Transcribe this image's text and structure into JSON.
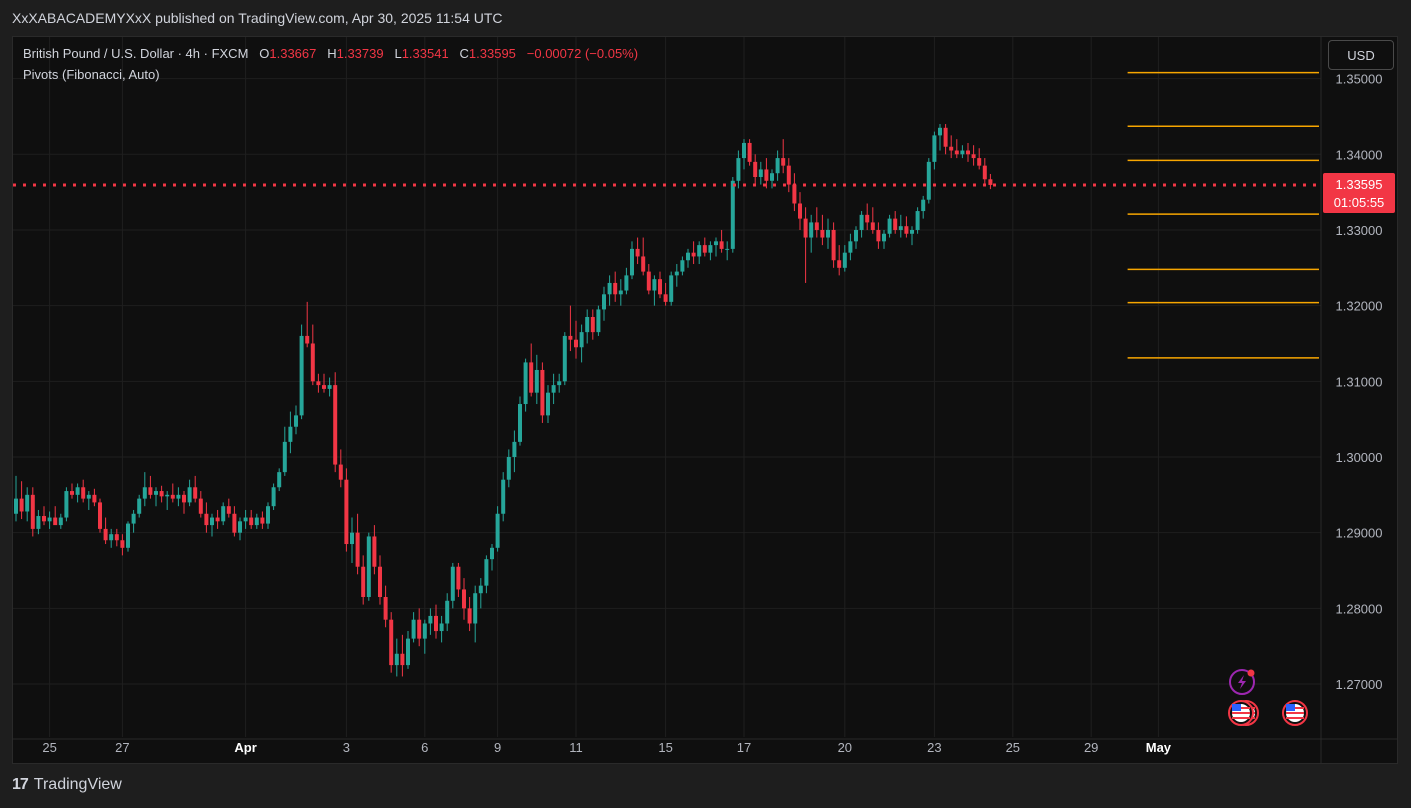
{
  "caption": "XxXABACADEMYXxX published on TradingView.com, Apr 30, 2025 11:54 UTC",
  "legend": {
    "symbol": "British Pound / U.S. Dollar · 4h · FXCM",
    "open_label": "O",
    "open": "1.33667",
    "high_label": "H",
    "high": "1.33739",
    "low_label": "L",
    "low": "1.33541",
    "close_label": "C",
    "close": "1.33595",
    "change": "−0.00072 (−0.05%)",
    "indicator": "Pivots (Fibonacci, Auto)"
  },
  "currency_button": "USD",
  "footer": {
    "brand": "TradingView",
    "logo": "17"
  },
  "colors": {
    "up": "#26a69a",
    "down": "#f23645",
    "pivot": "#f7a600",
    "price_line": "#f23645",
    "grid": "#1f1f1f",
    "axis_text": "#b2b5be"
  },
  "icons": [
    "lightning-icon",
    "us-flag-icon",
    "us-flag-icon"
  ],
  "chart_data": {
    "type": "candlestick",
    "interval": "4h",
    "y_axis": {
      "ylim": [
        1.263,
        1.3555
      ],
      "ticks": [
        "1.35000",
        "1.34000",
        "1.33000",
        "1.32000",
        "1.31000",
        "1.30000",
        "1.29000",
        "1.28000",
        "1.27000"
      ],
      "tick_values": [
        1.35,
        1.34,
        1.33,
        1.32,
        1.31,
        1.3,
        1.29,
        1.28,
        1.27
      ]
    },
    "x_axis": {
      "ticks": [
        "25",
        "27",
        "Apr",
        "3",
        "6",
        "9",
        "11",
        "15",
        "17",
        "20",
        "23",
        "25",
        "29",
        "May"
      ],
      "tick_index": [
        6,
        19,
        41,
        59,
        73,
        86,
        100,
        116,
        130,
        148,
        164,
        178,
        192,
        204
      ]
    },
    "last_price": {
      "price": "1.33595",
      "countdown": "01:05:55",
      "value": 1.33595
    },
    "pivot_levels": [
      {
        "value": 1.3508
      },
      {
        "value": 1.3437
      },
      {
        "value": 1.3392
      },
      {
        "value": 1.3321
      },
      {
        "value": 1.3248
      },
      {
        "value": 1.3204
      },
      {
        "value": 1.3131
      }
    ],
    "candles": [
      [
        1.2925,
        1.2975,
        1.2915,
        1.2945
      ],
      [
        1.2945,
        1.2968,
        1.2918,
        1.2928
      ],
      [
        1.2928,
        1.296,
        1.2915,
        1.295
      ],
      [
        1.295,
        1.296,
        1.2895,
        1.2905
      ],
      [
        1.2905,
        1.293,
        1.2898,
        1.2922
      ],
      [
        1.2922,
        1.2935,
        1.291,
        1.2915
      ],
      [
        1.2915,
        1.2928,
        1.2905,
        1.292
      ],
      [
        1.292,
        1.2935,
        1.2912,
        1.291
      ],
      [
        1.291,
        1.2925,
        1.2905,
        1.292
      ],
      [
        1.292,
        1.296,
        1.2915,
        1.2955
      ],
      [
        1.2955,
        1.2965,
        1.2945,
        1.295
      ],
      [
        1.295,
        1.2965,
        1.294,
        1.296
      ],
      [
        1.296,
        1.297,
        1.294,
        1.2945
      ],
      [
        1.2945,
        1.2955,
        1.293,
        1.295
      ],
      [
        1.295,
        1.2958,
        1.2935,
        1.294
      ],
      [
        1.294,
        1.2945,
        1.29,
        1.2905
      ],
      [
        1.2905,
        1.292,
        1.2885,
        1.289
      ],
      [
        1.289,
        1.2905,
        1.288,
        1.2898
      ],
      [
        1.2898,
        1.2905,
        1.2882,
        1.289
      ],
      [
        1.289,
        1.2898,
        1.287,
        1.288
      ],
      [
        1.288,
        1.2915,
        1.2875,
        1.2912
      ],
      [
        1.2912,
        1.293,
        1.29,
        1.2925
      ],
      [
        1.2925,
        1.295,
        1.292,
        1.2945
      ],
      [
        1.2945,
        1.298,
        1.2935,
        1.296
      ],
      [
        1.296,
        1.2975,
        1.2945,
        1.295
      ],
      [
        1.295,
        1.296,
        1.2935,
        1.2955
      ],
      [
        1.2955,
        1.2962,
        1.294,
        1.2948
      ],
      [
        1.2948,
        1.2955,
        1.293,
        1.295
      ],
      [
        1.295,
        1.2965,
        1.294,
        1.2945
      ],
      [
        1.2945,
        1.296,
        1.2935,
        1.295
      ],
      [
        1.295,
        1.2955,
        1.2925,
        1.294
      ],
      [
        1.294,
        1.297,
        1.2935,
        1.296
      ],
      [
        1.296,
        1.2975,
        1.294,
        1.2945
      ],
      [
        1.2945,
        1.2955,
        1.292,
        1.2925
      ],
      [
        1.2925,
        1.294,
        1.29,
        1.291
      ],
      [
        1.291,
        1.2925,
        1.2895,
        1.292
      ],
      [
        1.292,
        1.293,
        1.2905,
        1.2915
      ],
      [
        1.2915,
        1.294,
        1.291,
        1.2935
      ],
      [
        1.2935,
        1.2945,
        1.292,
        1.2925
      ],
      [
        1.2925,
        1.2935,
        1.2895,
        1.29
      ],
      [
        1.29,
        1.292,
        1.289,
        1.2915
      ],
      [
        1.2915,
        1.293,
        1.2905,
        1.292
      ],
      [
        1.292,
        1.293,
        1.2905,
        1.291
      ],
      [
        1.291,
        1.2925,
        1.2905,
        1.292
      ],
      [
        1.292,
        1.2928,
        1.2905,
        1.2912
      ],
      [
        1.2912,
        1.294,
        1.2905,
        1.2935
      ],
      [
        1.2935,
        1.2965,
        1.293,
        1.296
      ],
      [
        1.296,
        1.2985,
        1.2955,
        1.298
      ],
      [
        1.298,
        1.304,
        1.2975,
        1.302
      ],
      [
        1.302,
        1.306,
        1.3005,
        1.304
      ],
      [
        1.304,
        1.3068,
        1.303,
        1.3055
      ],
      [
        1.3055,
        1.3175,
        1.305,
        1.316
      ],
      [
        1.316,
        1.3205,
        1.3145,
        1.315
      ],
      [
        1.315,
        1.3175,
        1.3095,
        1.31
      ],
      [
        1.31,
        1.311,
        1.3085,
        1.3095
      ],
      [
        1.3095,
        1.311,
        1.3085,
        1.309
      ],
      [
        1.309,
        1.3105,
        1.308,
        1.3095
      ],
      [
        1.3095,
        1.3112,
        1.298,
        1.299
      ],
      [
        1.299,
        1.301,
        1.296,
        1.297
      ],
      [
        1.297,
        1.2985,
        1.2875,
        1.2885
      ],
      [
        1.2885,
        1.292,
        1.286,
        1.29
      ],
      [
        1.29,
        1.2925,
        1.2845,
        1.2855
      ],
      [
        1.2855,
        1.287,
        1.2805,
        1.2815
      ],
      [
        1.2815,
        1.29,
        1.281,
        1.2895
      ],
      [
        1.2895,
        1.291,
        1.2845,
        1.2855
      ],
      [
        1.2855,
        1.287,
        1.2805,
        1.2815
      ],
      [
        1.2815,
        1.283,
        1.2775,
        1.2785
      ],
      [
        1.2785,
        1.2795,
        1.2715,
        1.2725
      ],
      [
        1.2725,
        1.276,
        1.271,
        1.274
      ],
      [
        1.274,
        1.2765,
        1.271,
        1.2725
      ],
      [
        1.2725,
        1.277,
        1.272,
        1.276
      ],
      [
        1.276,
        1.2795,
        1.2755,
        1.2785
      ],
      [
        1.2785,
        1.28,
        1.275,
        1.276
      ],
      [
        1.276,
        1.2785,
        1.274,
        1.278
      ],
      [
        1.278,
        1.28,
        1.2765,
        1.279
      ],
      [
        1.279,
        1.2805,
        1.276,
        1.277
      ],
      [
        1.277,
        1.279,
        1.2755,
        1.278
      ],
      [
        1.278,
        1.282,
        1.277,
        1.281
      ],
      [
        1.281,
        1.286,
        1.28,
        1.2855
      ],
      [
        1.2855,
        1.286,
        1.2815,
        1.2825
      ],
      [
        1.2825,
        1.284,
        1.2785,
        1.28
      ],
      [
        1.28,
        1.2815,
        1.277,
        1.278
      ],
      [
        1.278,
        1.283,
        1.2755,
        1.282
      ],
      [
        1.282,
        1.284,
        1.28,
        1.283
      ],
      [
        1.283,
        1.287,
        1.282,
        1.2865
      ],
      [
        1.2865,
        1.2885,
        1.285,
        1.288
      ],
      [
        1.288,
        1.2935,
        1.2875,
        1.2925
      ],
      [
        1.2925,
        1.298,
        1.2915,
        1.297
      ],
      [
        1.297,
        1.301,
        1.296,
        1.3
      ],
      [
        1.3,
        1.3035,
        1.298,
        1.302
      ],
      [
        1.302,
        1.308,
        1.3015,
        1.307
      ],
      [
        1.307,
        1.313,
        1.306,
        1.3125
      ],
      [
        1.3125,
        1.315,
        1.308,
        1.3085
      ],
      [
        1.3085,
        1.3135,
        1.307,
        1.3115
      ],
      [
        1.3115,
        1.3125,
        1.3045,
        1.3055
      ],
      [
        1.3055,
        1.3095,
        1.3045,
        1.3085
      ],
      [
        1.3085,
        1.311,
        1.307,
        1.3095
      ],
      [
        1.3095,
        1.311,
        1.3085,
        1.31
      ],
      [
        1.31,
        1.3165,
        1.3095,
        1.316
      ],
      [
        1.316,
        1.32,
        1.314,
        1.3155
      ],
      [
        1.3155,
        1.318,
        1.313,
        1.3145
      ],
      [
        1.3145,
        1.3175,
        1.3125,
        1.3165
      ],
      [
        1.3165,
        1.3195,
        1.315,
        1.3185
      ],
      [
        1.3185,
        1.3195,
        1.3155,
        1.3165
      ],
      [
        1.3165,
        1.32,
        1.316,
        1.3195
      ],
      [
        1.3195,
        1.3225,
        1.318,
        1.3215
      ],
      [
        1.3215,
        1.324,
        1.32,
        1.323
      ],
      [
        1.323,
        1.3245,
        1.3205,
        1.3215
      ],
      [
        1.3215,
        1.3235,
        1.32,
        1.322
      ],
      [
        1.322,
        1.325,
        1.3215,
        1.324
      ],
      [
        1.324,
        1.3285,
        1.3235,
        1.3275
      ],
      [
        1.3275,
        1.329,
        1.3255,
        1.3265
      ],
      [
        1.3265,
        1.329,
        1.324,
        1.3245
      ],
      [
        1.3245,
        1.3255,
        1.3215,
        1.322
      ],
      [
        1.322,
        1.324,
        1.32,
        1.3235
      ],
      [
        1.3235,
        1.3245,
        1.321,
        1.3215
      ],
      [
        1.3215,
        1.323,
        1.32,
        1.3205
      ],
      [
        1.3205,
        1.3245,
        1.32,
        1.324
      ],
      [
        1.324,
        1.3255,
        1.3225,
        1.3245
      ],
      [
        1.3245,
        1.3265,
        1.324,
        1.326
      ],
      [
        1.326,
        1.3275,
        1.325,
        1.327
      ],
      [
        1.327,
        1.3285,
        1.3255,
        1.3265
      ],
      [
        1.3265,
        1.3285,
        1.3255,
        1.328
      ],
      [
        1.328,
        1.329,
        1.3265,
        1.327
      ],
      [
        1.327,
        1.3285,
        1.326,
        1.328
      ],
      [
        1.328,
        1.329,
        1.3265,
        1.3285
      ],
      [
        1.3285,
        1.33,
        1.327,
        1.3275
      ],
      [
        1.3275,
        1.3285,
        1.326,
        1.3275
      ],
      [
        1.3275,
        1.337,
        1.327,
        1.3365
      ],
      [
        1.3365,
        1.3405,
        1.3355,
        1.3395
      ],
      [
        1.3395,
        1.342,
        1.338,
        1.3415
      ],
      [
        1.3415,
        1.342,
        1.3385,
        1.339
      ],
      [
        1.339,
        1.34,
        1.336,
        1.337
      ],
      [
        1.337,
        1.339,
        1.336,
        1.338
      ],
      [
        1.338,
        1.3395,
        1.3355,
        1.3365
      ],
      [
        1.3365,
        1.338,
        1.3355,
        1.3375
      ],
      [
        1.3375,
        1.3405,
        1.3365,
        1.3395
      ],
      [
        1.3395,
        1.342,
        1.3375,
        1.3385
      ],
      [
        1.3385,
        1.3395,
        1.335,
        1.336
      ],
      [
        1.336,
        1.3375,
        1.3325,
        1.3335
      ],
      [
        1.3335,
        1.335,
        1.33,
        1.3315
      ],
      [
        1.3315,
        1.333,
        1.323,
        1.329
      ],
      [
        1.329,
        1.332,
        1.327,
        1.331
      ],
      [
        1.331,
        1.333,
        1.329,
        1.33
      ],
      [
        1.33,
        1.332,
        1.328,
        1.329
      ],
      [
        1.329,
        1.3315,
        1.3275,
        1.33
      ],
      [
        1.33,
        1.331,
        1.325,
        1.326
      ],
      [
        1.326,
        1.328,
        1.324,
        1.325
      ],
      [
        1.325,
        1.328,
        1.3245,
        1.327
      ],
      [
        1.327,
        1.3295,
        1.326,
        1.3285
      ],
      [
        1.3285,
        1.3305,
        1.3275,
        1.33
      ],
      [
        1.33,
        1.3325,
        1.329,
        1.332
      ],
      [
        1.332,
        1.3335,
        1.33,
        1.331
      ],
      [
        1.331,
        1.333,
        1.3295,
        1.33
      ],
      [
        1.33,
        1.331,
        1.3275,
        1.3285
      ],
      [
        1.3285,
        1.33,
        1.3275,
        1.3295
      ],
      [
        1.3295,
        1.332,
        1.329,
        1.3315
      ],
      [
        1.3315,
        1.3325,
        1.3295,
        1.33
      ],
      [
        1.33,
        1.332,
        1.329,
        1.3305
      ],
      [
        1.3305,
        1.3318,
        1.329,
        1.3295
      ],
      [
        1.3295,
        1.3305,
        1.328,
        1.33
      ],
      [
        1.33,
        1.333,
        1.3295,
        1.3325
      ],
      [
        1.3325,
        1.3345,
        1.3315,
        1.334
      ],
      [
        1.334,
        1.3395,
        1.3335,
        1.339
      ],
      [
        1.339,
        1.343,
        1.338,
        1.3425
      ],
      [
        1.3425,
        1.344,
        1.3405,
        1.3435
      ],
      [
        1.3435,
        1.344,
        1.34,
        1.341
      ],
      [
        1.341,
        1.3425,
        1.3395,
        1.3405
      ],
      [
        1.3405,
        1.342,
        1.3395,
        1.34
      ],
      [
        1.34,
        1.3412,
        1.3395,
        1.3405
      ],
      [
        1.3405,
        1.3415,
        1.339,
        1.34
      ],
      [
        1.34,
        1.3412,
        1.3385,
        1.3395
      ],
      [
        1.3395,
        1.3408,
        1.338,
        1.3385
      ],
      [
        1.3385,
        1.3395,
        1.336,
        1.3367
      ],
      [
        1.3367,
        1.3374,
        1.3354,
        1.33595
      ]
    ]
  }
}
